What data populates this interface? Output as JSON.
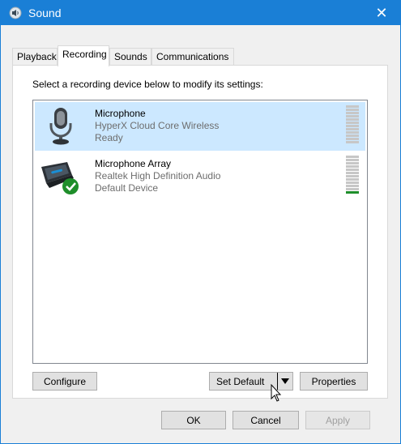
{
  "window": {
    "title": "Sound",
    "close_glyph": "✕"
  },
  "tabs": [
    {
      "label": "Playback",
      "active": false
    },
    {
      "label": "Recording",
      "active": true
    },
    {
      "label": "Sounds",
      "active": false
    },
    {
      "label": "Communications",
      "active": false
    }
  ],
  "recording": {
    "instruction": "Select a recording device below to modify its settings:",
    "devices": [
      {
        "name": "Microphone",
        "description": "HyperX Cloud Core Wireless",
        "status": "Ready",
        "icon": "microphone-icon",
        "selected": true,
        "level": 0
      },
      {
        "name": "Microphone Array",
        "description": "Realtek High Definition Audio",
        "status": "Default Device",
        "icon": "laptop-microphone-array-icon",
        "selected": false,
        "default": true,
        "level": 1
      }
    ],
    "buttons": {
      "configure": "Configure",
      "set_default": "Set Default",
      "properties": "Properties"
    }
  },
  "footer": {
    "ok": "OK",
    "cancel": "Cancel",
    "apply": "Apply"
  },
  "colors": {
    "titlebar": "#1a7fd6",
    "selected_row": "#cce8ff",
    "default_check": "#1e8e2a"
  }
}
